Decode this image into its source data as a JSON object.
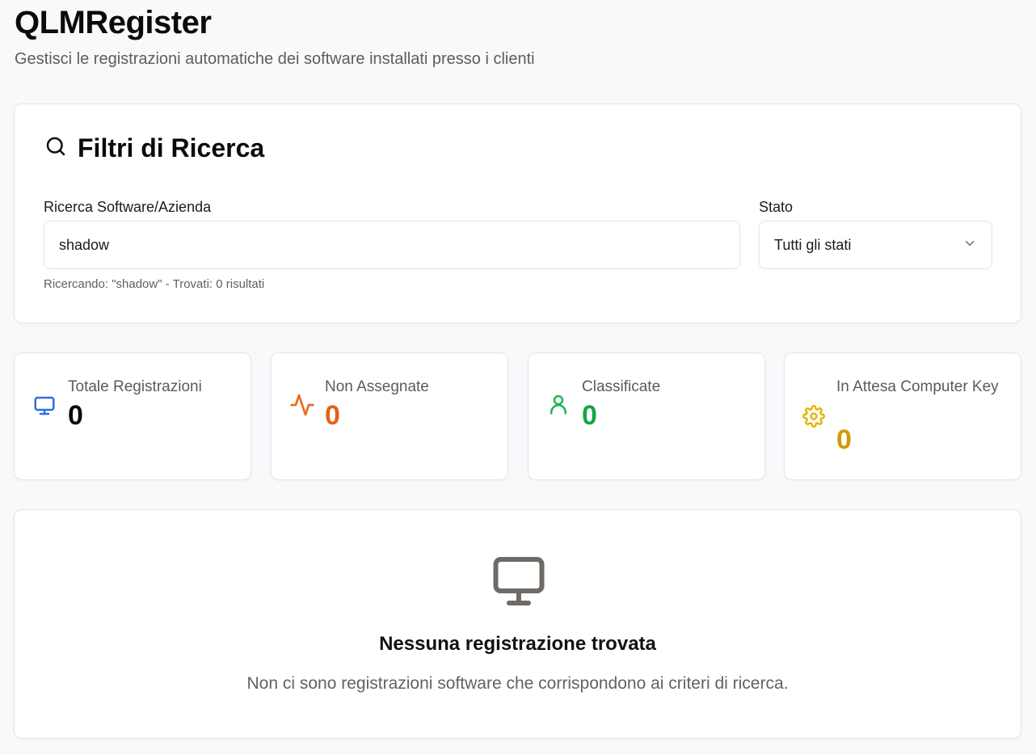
{
  "header": {
    "title": "QLMRegister",
    "subtitle": "Gestisci le registrazioni automatiche dei software installati presso i clienti"
  },
  "filters": {
    "title": "Filtri di Ricerca",
    "search_label": "Ricerca Software/Azienda",
    "search_value": "shadow",
    "search_hint": "Ricercando: \"shadow\" - Trovati: 0 risultati",
    "status_label": "Stato",
    "status_selected": "Tutti gli stati"
  },
  "stats": [
    {
      "label": "Totale Registrazioni",
      "value": "0",
      "icon": "monitor-icon",
      "color": "#2f6fe4",
      "value_color": "#0b0b0b"
    },
    {
      "label": "Non Assegnate",
      "value": "0",
      "icon": "activity-icon",
      "color": "#ea6a1d",
      "value_color": "#e4611b"
    },
    {
      "label": "Classificate",
      "value": "0",
      "icon": "user-icon",
      "color": "#22b358",
      "value_color": "#17a34a"
    },
    {
      "label": "In Attesa Computer Key",
      "value": "0",
      "icon": "gear-icon",
      "color": "#e6b100",
      "value_color": "#cf9a06"
    }
  ],
  "empty_state": {
    "icon": "monitor-icon",
    "title": "Nessuna registrazione trovata",
    "text": "Non ci sono registrazioni software che corrispondono ai criteri di ricerca."
  }
}
